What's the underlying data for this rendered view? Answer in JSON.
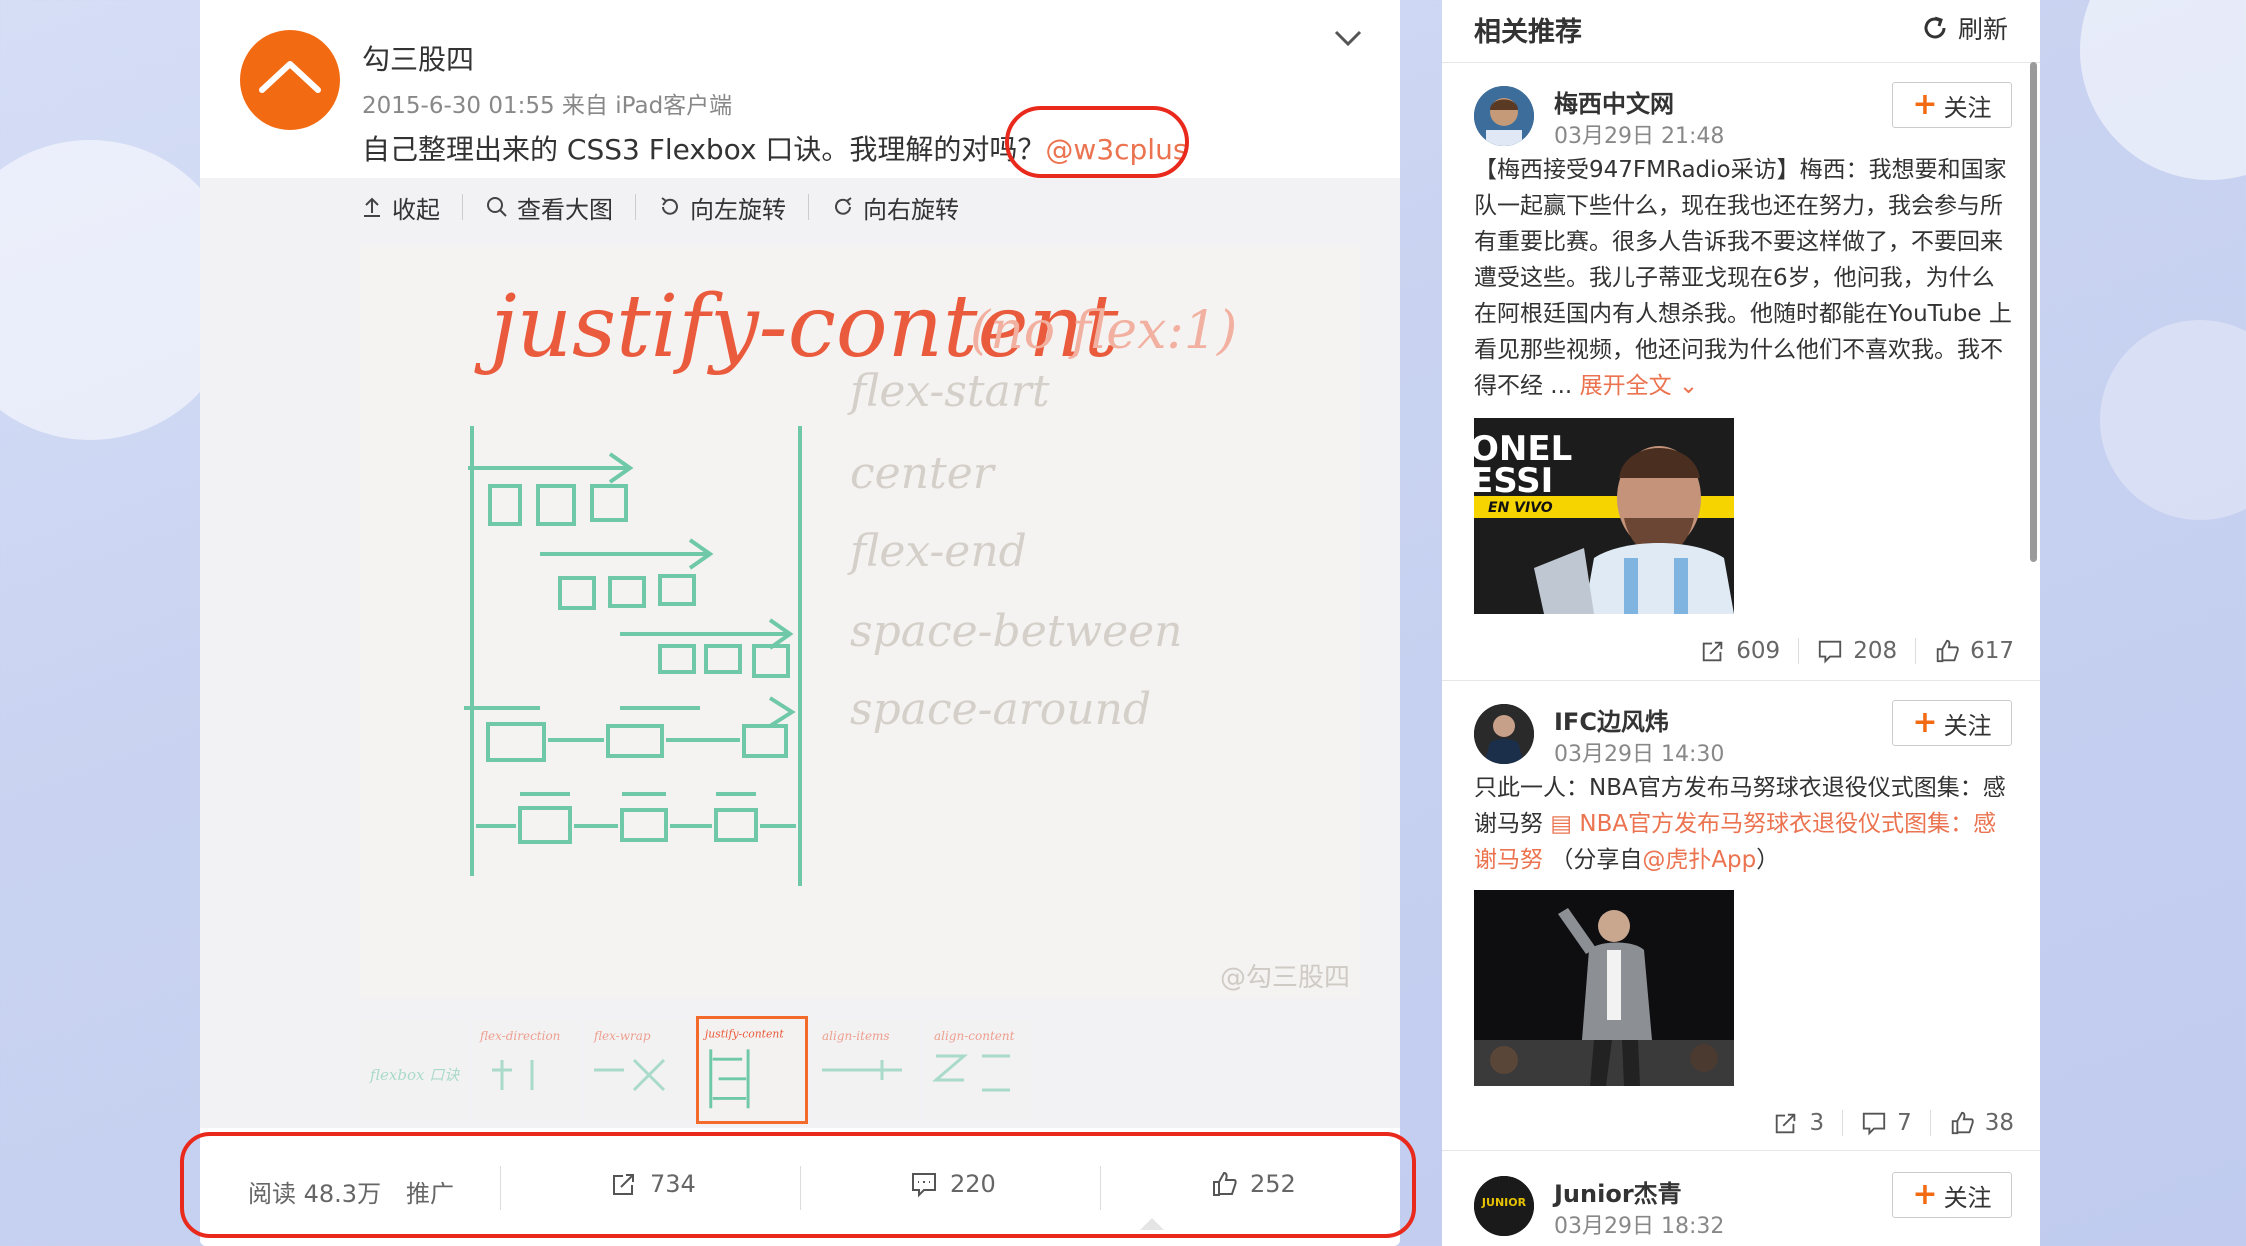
{
  "post": {
    "author": "勾三股四",
    "meta": "2015-6-30 01:55 来自 iPad客户端",
    "text_prefix": "自己整理出来的 CSS3 Flexbox 口诀。我理解的对吗？",
    "mention": "@w3cplus",
    "toolbar": {
      "collapse": "收起",
      "view_large": "查看大图",
      "rotate_left": "向左旋转",
      "rotate_right": "向右旋转"
    },
    "image": {
      "title": "justify-content",
      "note": "(no flex:1)",
      "labels": [
        "flex-start",
        "center",
        "flex-end",
        "space-between",
        "space-around"
      ],
      "watermark": "@勾三股四"
    },
    "thumbnails": [
      "flexbox 口诀",
      "flex-direction",
      "flex-wrap",
      "justify-content",
      "align-items",
      "align-content"
    ],
    "stats": {
      "read": "阅读 48.3万",
      "promote": "推广",
      "reposts": "734",
      "comments": "220",
      "likes": "252"
    }
  },
  "sidebar": {
    "title": "相关推荐",
    "refresh": "刷新",
    "follow_label": "关注",
    "items": [
      {
        "name": "梅西中文网",
        "time": "03月29日 21:48",
        "text": "【梅西接受947FMRadio采访】梅西：我想要和国家队一起赢下些什么，现在我也还在努力，我会参与所有重要比赛。很多人告诉我不要这样做了，不要回来遭受这些。我儿子蒂亚戈现在6岁，他问我，为什么在阿根廷国内有人想杀我。他随时都能在YouTube 上看见那些视频，他还问我为什么他们不喜欢我。我不得不经 ...",
        "expand": "展开全文",
        "image_text": [
          "ONEL",
          "ESSI",
          "EN VIVO"
        ],
        "reposts": "609",
        "comments": "208",
        "likes": "617"
      },
      {
        "name": "IFC边风炜",
        "time": "03月29日 14:30",
        "text_prefix": "只此一人：NBA官方发布马努球衣退役仪式图集：感谢马努",
        "link_text": "NBA官方发布马努球衣退役仪式图集：感谢马努",
        "share_prefix": "（分享自",
        "share_link": "@虎扑App",
        "share_suffix": "）",
        "reposts": "3",
        "comments": "7",
        "likes": "38"
      },
      {
        "name": "Junior杰青",
        "time": "03月29日 18:32",
        "avatar_text": "JUNIOR"
      }
    ]
  }
}
